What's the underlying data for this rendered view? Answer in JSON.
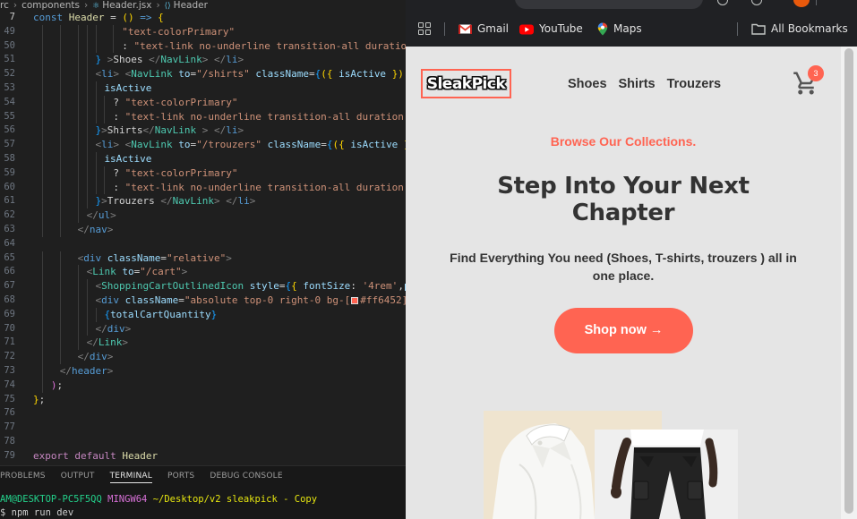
{
  "editor": {
    "breadcrumb": [
      "rc",
      "components",
      "Header.jsx",
      "Header"
    ],
    "lines": [
      {
        "n": 7,
        "tokens": [
          [
            "kw",
            "const "
          ],
          [
            "fn",
            "Header"
          ],
          [
            "txt",
            " = "
          ],
          [
            "br",
            "()"
          ],
          [
            "kw",
            " =>"
          ],
          [
            "txt",
            " "
          ],
          [
            "br",
            "{"
          ]
        ]
      },
      {
        "n": 49,
        "tokens": [
          [
            "str",
            "\"text-colorPrimary\""
          ]
        ]
      },
      {
        "n": 50,
        "tokens": [
          [
            "txt",
            ": "
          ],
          [
            "str",
            "\"text-link no-underline transition-all duration"
          ]
        ]
      },
      {
        "n": 51,
        "tokens": [
          [
            "br3",
            "}"
          ],
          [
            "txt",
            " "
          ],
          [
            "pun",
            ">"
          ],
          [
            "txt",
            "Shoes "
          ],
          [
            "pun",
            "</"
          ],
          [
            "tag",
            "NavLink"
          ],
          [
            "pun",
            ">"
          ],
          [
            "txt",
            " "
          ],
          [
            "pun",
            "</"
          ],
          [
            "htag",
            "li"
          ],
          [
            "pun",
            ">"
          ]
        ]
      },
      {
        "n": 52,
        "tokens": [
          [
            "pun",
            "<"
          ],
          [
            "htag",
            "li"
          ],
          [
            "pun",
            ">"
          ],
          [
            "txt",
            " "
          ],
          [
            "pun",
            "<"
          ],
          [
            "tag",
            "NavLink"
          ],
          [
            "txt",
            " "
          ],
          [
            "attr",
            "to"
          ],
          [
            "txt",
            "="
          ],
          [
            "str",
            "\"/shirts\""
          ],
          [
            "txt",
            " "
          ],
          [
            "attr",
            "className"
          ],
          [
            "txt",
            "="
          ],
          [
            "br3",
            "{"
          ],
          [
            "br",
            "({"
          ],
          [
            "txt",
            " "
          ],
          [
            "var",
            "isActive"
          ],
          [
            "txt",
            " "
          ],
          [
            "br",
            "})"
          ]
        ]
      },
      {
        "n": 53,
        "tokens": [
          [
            "var",
            "isActive"
          ]
        ]
      },
      {
        "n": 54,
        "tokens": [
          [
            "txt",
            "? "
          ],
          [
            "str",
            "\"text-colorPrimary\""
          ]
        ]
      },
      {
        "n": 55,
        "tokens": [
          [
            "txt",
            ": "
          ],
          [
            "str",
            "\"text-link no-underline transition-all duration"
          ]
        ]
      },
      {
        "n": 56,
        "tokens": [
          [
            "br3",
            "}"
          ],
          [
            "pun",
            ">"
          ],
          [
            "txt",
            "Shirts"
          ],
          [
            "pun",
            "</"
          ],
          [
            "tag",
            "NavLink"
          ],
          [
            "txt",
            " "
          ],
          [
            "pun",
            ">"
          ],
          [
            "txt",
            " "
          ],
          [
            "pun",
            "</"
          ],
          [
            "htag",
            "li"
          ],
          [
            "pun",
            ">"
          ]
        ]
      },
      {
        "n": 57,
        "tokens": [
          [
            "pun",
            "<"
          ],
          [
            "htag",
            "li"
          ],
          [
            "pun",
            ">"
          ],
          [
            "txt",
            " "
          ],
          [
            "pun",
            "<"
          ],
          [
            "tag",
            "NavLink"
          ],
          [
            "txt",
            " "
          ],
          [
            "attr",
            "to"
          ],
          [
            "txt",
            "="
          ],
          [
            "str",
            "\"/trouzers\""
          ],
          [
            "txt",
            " "
          ],
          [
            "attr",
            "className"
          ],
          [
            "txt",
            "="
          ],
          [
            "br3",
            "{"
          ],
          [
            "br",
            "({"
          ],
          [
            "txt",
            " "
          ],
          [
            "var",
            "isActive"
          ],
          [
            "txt",
            " "
          ],
          [
            "br",
            "}"
          ]
        ]
      },
      {
        "n": 58,
        "tokens": [
          [
            "var",
            "isActive"
          ]
        ]
      },
      {
        "n": 59,
        "tokens": [
          [
            "txt",
            "? "
          ],
          [
            "str",
            "\"text-colorPrimary\""
          ]
        ]
      },
      {
        "n": 60,
        "tokens": [
          [
            "txt",
            ": "
          ],
          [
            "str",
            "\"text-link no-underline transition-all duration"
          ]
        ]
      },
      {
        "n": 61,
        "tokens": [
          [
            "br3",
            "}"
          ],
          [
            "pun",
            ">"
          ],
          [
            "txt",
            "Trouzers "
          ],
          [
            "pun",
            "</"
          ],
          [
            "tag",
            "NavLink"
          ],
          [
            "pun",
            ">"
          ],
          [
            "txt",
            " "
          ],
          [
            "pun",
            "</"
          ],
          [
            "htag",
            "li"
          ],
          [
            "pun",
            ">"
          ]
        ]
      },
      {
        "n": 62,
        "tokens": [
          [
            "pun",
            "</"
          ],
          [
            "htag",
            "ul"
          ],
          [
            "pun",
            ">"
          ]
        ]
      },
      {
        "n": 63,
        "tokens": [
          [
            "pun",
            "</"
          ],
          [
            "htag",
            "nav"
          ],
          [
            "pun",
            ">"
          ]
        ]
      },
      {
        "n": 64,
        "tokens": []
      },
      {
        "n": 65,
        "tokens": [
          [
            "pun",
            "<"
          ],
          [
            "htag",
            "div"
          ],
          [
            "txt",
            " "
          ],
          [
            "attr",
            "className"
          ],
          [
            "txt",
            "="
          ],
          [
            "str",
            "\"relative\""
          ],
          [
            "pun",
            ">"
          ]
        ]
      },
      {
        "n": 66,
        "tokens": [
          [
            "pun",
            "<"
          ],
          [
            "tag",
            "Link"
          ],
          [
            "txt",
            " "
          ],
          [
            "attr",
            "to"
          ],
          [
            "txt",
            "="
          ],
          [
            "str",
            "\"/cart\""
          ],
          [
            "pun",
            ">"
          ]
        ]
      },
      {
        "n": 67,
        "tokens": [
          [
            "pun",
            "<"
          ],
          [
            "tag",
            "ShoppingCartOutlinedIcon"
          ],
          [
            "txt",
            " "
          ],
          [
            "attr",
            "style"
          ],
          [
            "txt",
            "="
          ],
          [
            "br3",
            "{"
          ],
          [
            "br",
            "{"
          ],
          [
            "txt",
            " "
          ],
          [
            "attr",
            "fontSize"
          ],
          [
            "txt",
            ": "
          ],
          [
            "str",
            "'4rem'"
          ],
          [
            "txt",
            ","
          ],
          [
            "attr",
            "p"
          ]
        ]
      },
      {
        "n": 68,
        "tokens": [
          [
            "pun",
            "<"
          ],
          [
            "htag",
            "div"
          ],
          [
            "txt",
            " "
          ],
          [
            "attr",
            "className"
          ],
          [
            "txt",
            "="
          ],
          [
            "str",
            "\"absolute top-0 right-0 bg-["
          ],
          [
            "swatch",
            ""
          ],
          [
            "str",
            "#ff6452]"
          ]
        ]
      },
      {
        "n": 69,
        "tokens": [
          [
            "br3",
            "{"
          ],
          [
            "var",
            "totalCartQuantity"
          ],
          [
            "br3",
            "}"
          ]
        ]
      },
      {
        "n": 70,
        "tokens": [
          [
            "pun",
            "</"
          ],
          [
            "htag",
            "div"
          ],
          [
            "pun",
            ">"
          ]
        ]
      },
      {
        "n": 71,
        "tokens": [
          [
            "pun",
            "</"
          ],
          [
            "tag",
            "Link"
          ],
          [
            "pun",
            ">"
          ]
        ]
      },
      {
        "n": 72,
        "tokens": [
          [
            "pun",
            "</"
          ],
          [
            "htag",
            "div"
          ],
          [
            "pun",
            ">"
          ]
        ]
      },
      {
        "n": 73,
        "tokens": [
          [
            "pun",
            "</"
          ],
          [
            "htag",
            "header"
          ],
          [
            "pun",
            ">"
          ]
        ]
      },
      {
        "n": 74,
        "tokens": [
          [
            "br2",
            ")"
          ],
          [
            "txt",
            ";"
          ]
        ]
      },
      {
        "n": 75,
        "tokens": [
          [
            "br",
            "}"
          ],
          [
            "txt",
            ";"
          ]
        ]
      },
      {
        "n": 76,
        "tokens": []
      },
      {
        "n": 77,
        "tokens": []
      },
      {
        "n": 78,
        "tokens": []
      },
      {
        "n": 79,
        "tokens": [
          [
            "ctl",
            "export "
          ],
          [
            "ctl",
            "default "
          ],
          [
            "fn",
            "Header"
          ]
        ]
      }
    ]
  },
  "panel": {
    "tabs": [
      "PROBLEMS",
      "OUTPUT",
      "TERMINAL",
      "PORTS",
      "DEBUG CONSOLE"
    ],
    "active_tab": "TERMINAL",
    "prompt_user": "AM@DESKTOP-PC5F5QQ",
    "prompt_env": "MINGW64",
    "prompt_path": "~/Desktop/v2 sleakpick - Copy",
    "command": "$ npm run dev"
  },
  "browser": {
    "bookmarks": {
      "gmail": "Gmail",
      "youtube": "YouTube",
      "maps": "Maps",
      "all": "All Bookmarks"
    }
  },
  "site": {
    "logo": "SleakPick",
    "nav": [
      "Shoes",
      "Shirts",
      "Trouzers"
    ],
    "cart_count": "3",
    "eyebrow": "Browse Our Collections.",
    "headline": "Step Into Your Next Chapter",
    "subtitle": "Find Everything You need (Shoes, T-shirts, trouzers ) all in one place.",
    "cta": "Shop now →"
  },
  "colors": {
    "primary": "#ff6452",
    "page_bg": "#e5e5e5",
    "text_dark": "#333333",
    "editor_bg": "#1f1f1f",
    "browser_chrome": "#202124"
  }
}
